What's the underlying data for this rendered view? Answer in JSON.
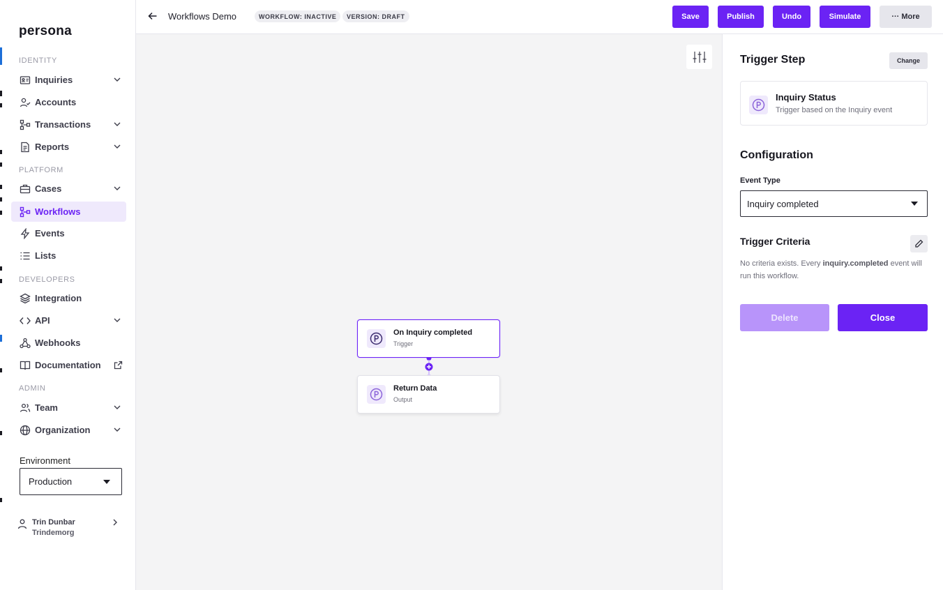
{
  "colors": {
    "accent": "#6b23f4",
    "accent_soft": "#efe9fc",
    "disabled_accent": "#b894fa",
    "canvas_bg": "#f4f4f5"
  },
  "sidebar": {
    "logo": "persona",
    "sections": {
      "identity": "IDENTITY",
      "platform": "PLATFORM",
      "developers": "DEVELOPERS",
      "admin": "ADMIN"
    },
    "items": [
      {
        "label": "Inquiries",
        "icon": "id-card-icon"
      },
      {
        "label": "Accounts",
        "icon": "user-check-icon"
      },
      {
        "label": "Transactions",
        "icon": "transactions-icon"
      },
      {
        "label": "Reports",
        "icon": "report-icon"
      },
      {
        "label": "Cases",
        "icon": "briefcase-icon"
      },
      {
        "label": "Workflows",
        "icon": "workflow-icon",
        "active": true
      },
      {
        "label": "Events",
        "icon": "bolt-icon"
      },
      {
        "label": "Lists",
        "icon": "list-icon"
      },
      {
        "label": "Integration",
        "icon": "layers-icon"
      },
      {
        "label": "API",
        "icon": "code-icon"
      },
      {
        "label": "Webhooks",
        "icon": "webhook-icon"
      },
      {
        "label": "Documentation",
        "icon": "book-icon"
      },
      {
        "label": "Team",
        "icon": "team-icon"
      },
      {
        "label": "Organization",
        "icon": "globe-icon"
      }
    ],
    "environment": {
      "label": "Environment",
      "value": "Production"
    },
    "user": {
      "name": "Trin Dunbar",
      "org": "Trindemorg"
    }
  },
  "header": {
    "title": "Workflows Demo",
    "badges": [
      "WORKFLOW: INACTIVE",
      "VERSION: DRAFT"
    ],
    "buttons": {
      "save": "Save",
      "publish": "Publish",
      "undo": "Undo",
      "simulate": "Simulate",
      "more": "··· More"
    }
  },
  "canvas": {
    "nodes": [
      {
        "title": "On Inquiry completed",
        "subtitle": "Trigger"
      },
      {
        "title": "Return Data",
        "subtitle": "Output"
      }
    ]
  },
  "panel": {
    "title": "Trigger Step",
    "change": "Change",
    "trigger_card": {
      "title": "Inquiry Status",
      "subtitle": "Trigger based on the Inquiry event"
    },
    "configuration": "Configuration",
    "event_type_label": "Event Type",
    "event_type_value": "Inquiry completed",
    "criteria_title": "Trigger Criteria",
    "criteria_pre": "No criteria exists. Every ",
    "criteria_bold": "inquiry.completed",
    "criteria_post": " event will run this workflow.",
    "delete": "Delete",
    "close": "Close"
  }
}
